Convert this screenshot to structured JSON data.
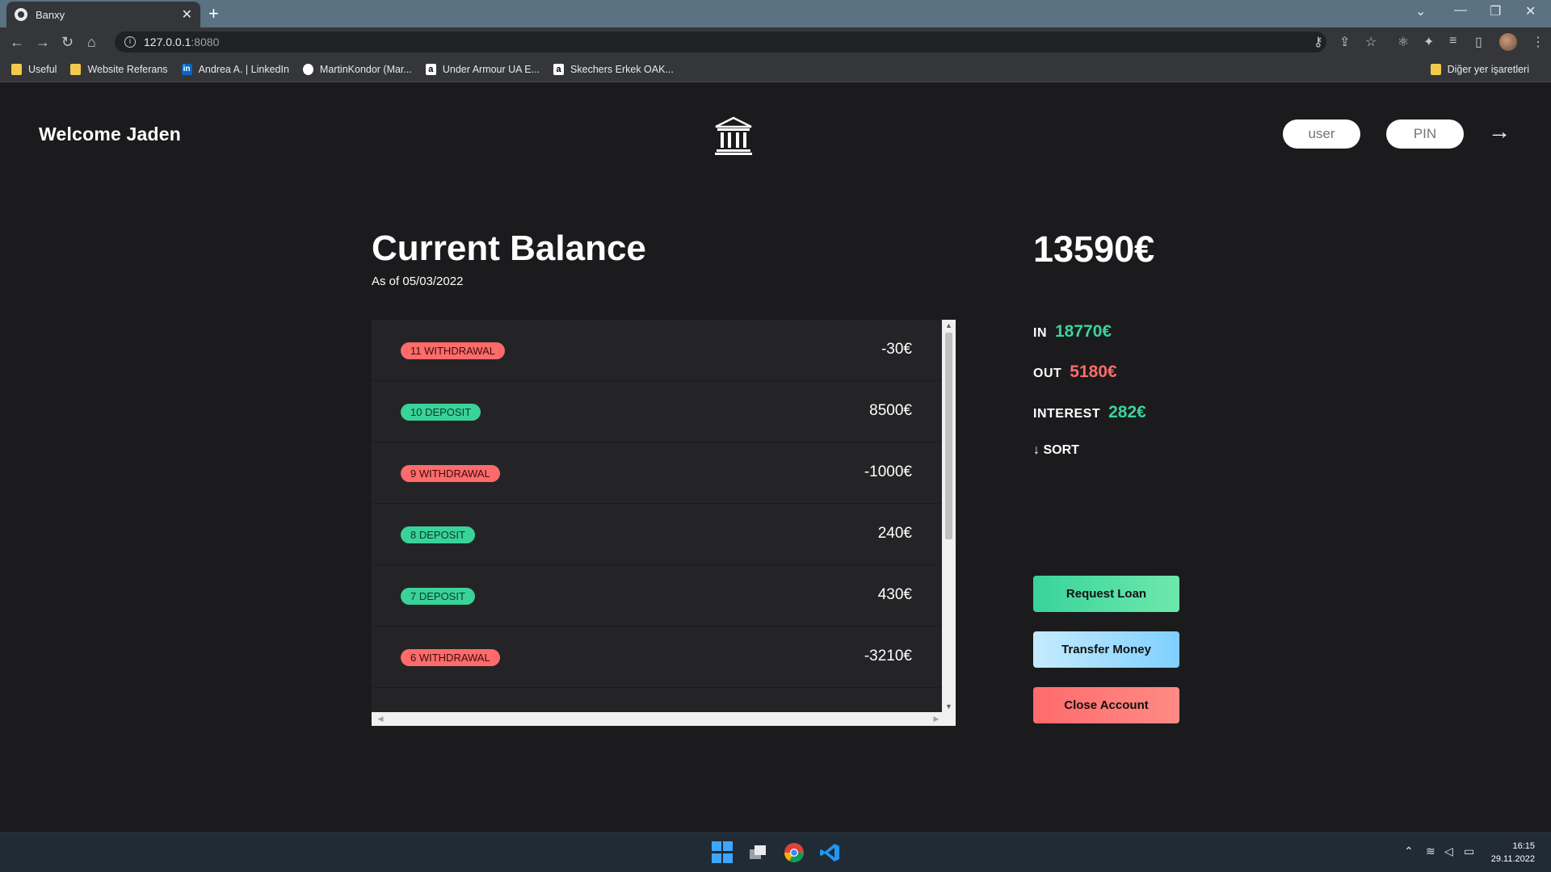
{
  "browser": {
    "tab_title": "Banxy",
    "url_host": "127.0.0.1",
    "url_port": ":8080",
    "bookmarks": [
      "Useful",
      "Website Referans",
      "Andrea A. | LinkedIn",
      "MartinKondor (Mar...",
      "Under Armour UA E...",
      "Skechers Erkek OAK..."
    ],
    "other_bookmarks": "Diğer yer işaretleri"
  },
  "header": {
    "welcome": "Welcome Jaden",
    "logo_icon": "bank-icon",
    "user_placeholder": "user",
    "pin_placeholder": "PIN",
    "login_arrow": "→"
  },
  "balance": {
    "title": "Current Balance",
    "date_label": "As of 05/03/2022",
    "value": "13590€"
  },
  "movements": [
    {
      "label": "11 WITHDRAWAL",
      "type": "withdrawal",
      "amount": "-30€"
    },
    {
      "label": "10 DEPOSIT",
      "type": "deposit",
      "amount": "8500€"
    },
    {
      "label": "9 WITHDRAWAL",
      "type": "withdrawal",
      "amount": "-1000€"
    },
    {
      "label": "8 DEPOSIT",
      "type": "deposit",
      "amount": "240€"
    },
    {
      "label": "7 DEPOSIT",
      "type": "deposit",
      "amount": "430€"
    },
    {
      "label": "6 WITHDRAWAL",
      "type": "withdrawal",
      "amount": "-3210€"
    }
  ],
  "summary": {
    "in_label": "IN",
    "in_value": "18770€",
    "out_label": "OUT",
    "out_value": "5180€",
    "interest_label": "INTEREST",
    "interest_value": "282€",
    "sort_label": "↓ SORT"
  },
  "operations": {
    "loan": "Request Loan",
    "transfer": "Transfer Money",
    "close": "Close Account"
  },
  "colors": {
    "deposit": "#39d39a",
    "withdrawal": "#ff6b6b",
    "background": "#1b1b1d"
  },
  "taskbar": {
    "time": "16:15",
    "date": "29.11.2022"
  }
}
